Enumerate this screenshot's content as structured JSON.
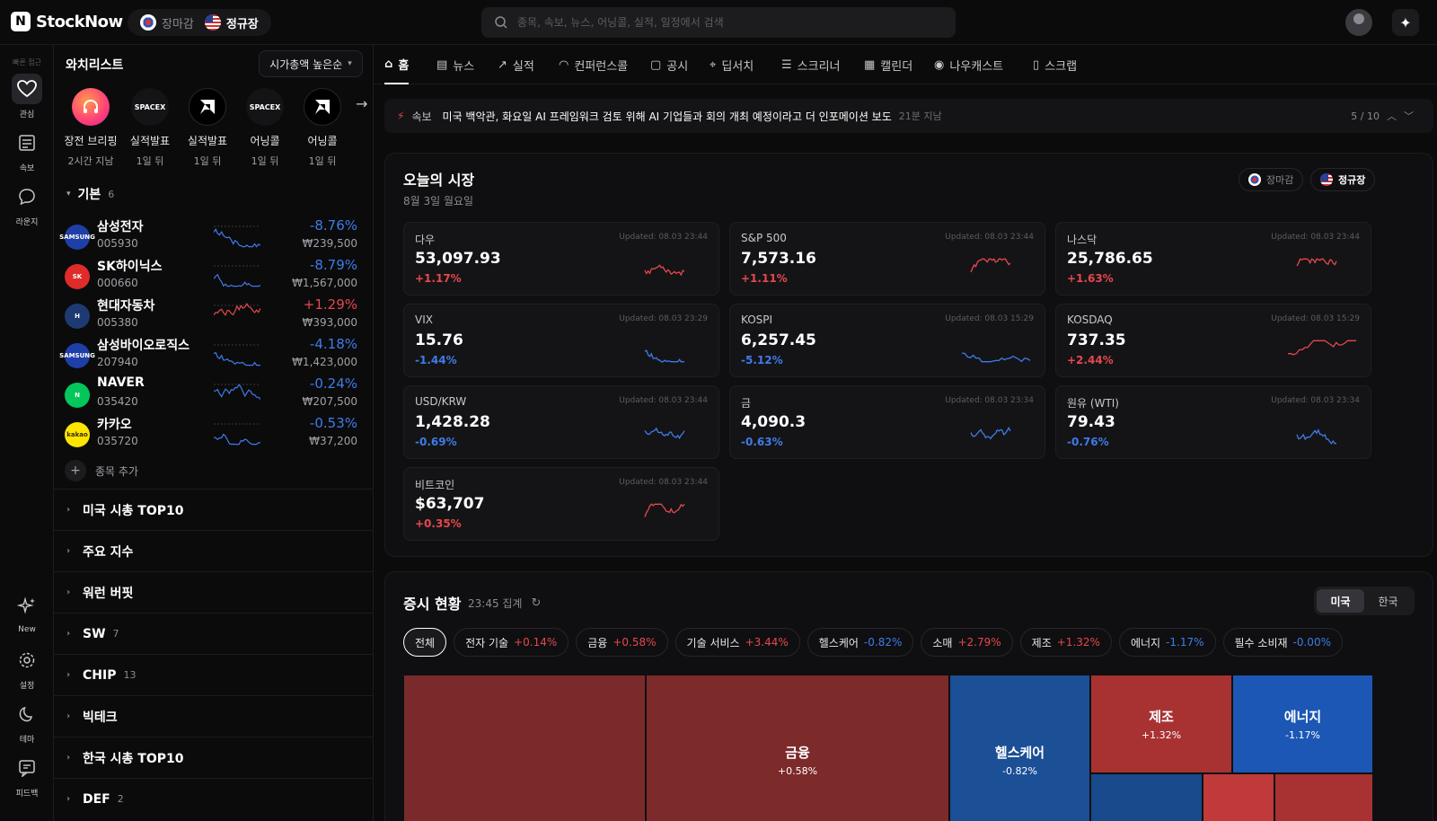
{
  "app": {
    "name": "StockNow",
    "market_kr": "장마감",
    "market_us": "정규장",
    "search_placeholder": "종목, 속보, 뉴스, 어닝콜, 실적, 일정에서 검색"
  },
  "rail": {
    "header": "빠른 접근",
    "items": [
      {
        "label": "관심",
        "icon": "heart-icon"
      },
      {
        "label": "속보",
        "icon": "news-icon"
      },
      {
        "label": "라운지",
        "icon": "chat-icon"
      },
      {
        "label": "New",
        "icon": "sparkle-icon"
      },
      {
        "label": "설정",
        "icon": "gear-icon"
      },
      {
        "label": "테마",
        "icon": "moon-icon"
      },
      {
        "label": "피드백",
        "icon": "feedback-icon"
      }
    ]
  },
  "watchlist": {
    "title": "와치리스트",
    "sort_label": "시가총액 높은순",
    "stories": [
      {
        "label": "장전 브리핑",
        "time": "2시간 지남",
        "logo": ""
      },
      {
        "label": "실적발표",
        "time": "1일 뒤",
        "logo": "SPACEX"
      },
      {
        "label": "실적발표",
        "time": "1일 뒤",
        "logo": "AMD"
      },
      {
        "label": "어닝콜",
        "time": "1일 뒤",
        "logo": "SPACEX"
      },
      {
        "label": "어닝콜",
        "time": "1일 뒤",
        "logo": "AMD"
      }
    ],
    "group_name": "기본",
    "group_count": "6",
    "stocks": [
      {
        "name": "삼성전자",
        "code": "005930",
        "change": "-8.76%",
        "price": "₩239,500",
        "dir": "down",
        "logo": "SAMSUNG",
        "color": "#1f3fa8"
      },
      {
        "name": "SK하이닉스",
        "code": "000660",
        "change": "-8.79%",
        "price": "₩1,567,000",
        "dir": "down",
        "logo": "SK",
        "color": "#e02b2b"
      },
      {
        "name": "현대자동차",
        "code": "005380",
        "change": "+1.29%",
        "price": "₩393,000",
        "dir": "up",
        "logo": "H",
        "color": "#1d3b72"
      },
      {
        "name": "삼성바이오로직스",
        "code": "207940",
        "change": "-4.18%",
        "price": "₩1,423,000",
        "dir": "down",
        "logo": "SAMSUNG",
        "color": "#1f3fa8"
      },
      {
        "name": "NAVER",
        "code": "035420",
        "change": "-0.24%",
        "price": "₩207,500",
        "dir": "down",
        "logo": "N",
        "color": "#03c75a"
      },
      {
        "name": "카카오",
        "code": "035720",
        "change": "-0.53%",
        "price": "₩37,200",
        "dir": "down",
        "logo": "kakao",
        "color": "#fee500"
      }
    ],
    "add_label": "종목 추가",
    "folders": [
      {
        "name": "미국 시총 TOP10",
        "count": ""
      },
      {
        "name": "주요 지수",
        "count": ""
      },
      {
        "name": "워런 버핏",
        "count": ""
      },
      {
        "name": "SW",
        "count": "7"
      },
      {
        "name": "CHIP",
        "count": "13"
      },
      {
        "name": "빅테크",
        "count": ""
      },
      {
        "name": "한국 시총 TOP10",
        "count": ""
      },
      {
        "name": "DEF",
        "count": "2"
      }
    ]
  },
  "tabs": [
    {
      "label": "홈",
      "icon": "home-icon"
    },
    {
      "label": "뉴스",
      "icon": "newspaper-icon"
    },
    {
      "label": "실적",
      "icon": "trend-icon"
    },
    {
      "label": "컨퍼런스콜",
      "icon": "headphones-icon"
    },
    {
      "label": "공시",
      "icon": "clipboard-icon"
    },
    {
      "label": "딥서치",
      "icon": "telescope-icon"
    },
    {
      "label": "스크리너",
      "icon": "sliders-icon"
    },
    {
      "label": "캘린더",
      "icon": "calendar-icon"
    },
    {
      "label": "나우캐스트",
      "icon": "broadcast-icon"
    },
    {
      "label": "스크랩",
      "icon": "bookmark-icon"
    }
  ],
  "ticker": {
    "label": "속보",
    "text": "미국 백악관, 화요일 AI 프레임워크 검토 위해 AI 기업들과 회의 개최 예정이라고 더 인포메이션 보도",
    "time": "21분 지남",
    "page": "5 / 10"
  },
  "market": {
    "title": "오늘의 시장",
    "date": "8월 3일 월요일",
    "kr_status": "장마감",
    "us_status": "정규장",
    "cards": [
      {
        "name": "다우",
        "updated": "Updated: 08.03 23:44",
        "value": "53,097.93",
        "change": "+1.17%",
        "dir": "up"
      },
      {
        "name": "S&P 500",
        "updated": "Updated: 08.03 23:44",
        "value": "7,573.16",
        "change": "+1.11%",
        "dir": "up"
      },
      {
        "name": "나스닥",
        "updated": "Updated: 08.03 23:44",
        "value": "25,786.65",
        "change": "+1.63%",
        "dir": "up"
      },
      {
        "name": "VIX",
        "updated": "Updated: 08.03 23:29",
        "value": "15.76",
        "change": "-1.44%",
        "dir": "down"
      },
      {
        "name": "KOSPI",
        "updated": "Updated: 08.03 15:29",
        "value": "6,257.45",
        "change": "-5.12%",
        "dir": "down"
      },
      {
        "name": "KOSDAQ",
        "updated": "Updated: 08.03 15:29",
        "value": "737.35",
        "change": "+2.44%",
        "dir": "up"
      },
      {
        "name": "USD/KRW",
        "updated": "Updated: 08.03 23:44",
        "value": "1,428.28",
        "change": "-0.69%",
        "dir": "down"
      },
      {
        "name": "금",
        "updated": "Updated: 08.03 23:34",
        "value": "4,090.3",
        "change": "-0.63%",
        "dir": "down"
      },
      {
        "name": "원유 (WTI)",
        "updated": "Updated: 08.03 23:34",
        "value": "79.43",
        "change": "-0.76%",
        "dir": "down"
      },
      {
        "name": "비트코인",
        "updated": "Updated: 08.03 23:44",
        "value": "$63,707",
        "change": "+0.35%",
        "dir": "up"
      }
    ]
  },
  "sectors": {
    "title": "증시 현황",
    "time": "23:45 집계",
    "seg_us": "미국",
    "seg_kr": "한국",
    "chips": [
      {
        "name": "전체",
        "change": "",
        "dir": ""
      },
      {
        "name": "전자 기술",
        "change": "+0.14%",
        "dir": "up"
      },
      {
        "name": "금융",
        "change": "+0.58%",
        "dir": "up"
      },
      {
        "name": "기술 서비스",
        "change": "+3.44%",
        "dir": "up"
      },
      {
        "name": "헬스케어",
        "change": "-0.82%",
        "dir": "down"
      },
      {
        "name": "소매",
        "change": "+2.79%",
        "dir": "up"
      },
      {
        "name": "제조",
        "change": "+1.32%",
        "dir": "up"
      },
      {
        "name": "에너지",
        "change": "-1.17%",
        "dir": "down"
      },
      {
        "name": "필수 소비재",
        "change": "-0.00%",
        "dir": "down"
      }
    ],
    "treemap": [
      {
        "name": "",
        "change": "",
        "color": "#7a2a2a"
      },
      {
        "name": "금융",
        "change": "+0.58%",
        "color": "#7d2a2a"
      },
      {
        "name": "헬스케어",
        "change": "-0.82%",
        "color": "#1b4f96"
      },
      {
        "name": "제조",
        "change": "+1.32%",
        "color": "#a83232"
      },
      {
        "name": "에너지",
        "change": "-1.17%",
        "color": "#1c57b5"
      },
      {
        "name": "",
        "change": "",
        "color": "#184a8c"
      },
      {
        "name": "",
        "change": "",
        "color": "#c03a3a"
      },
      {
        "name": "",
        "change": "",
        "color": "#a83232"
      }
    ]
  }
}
